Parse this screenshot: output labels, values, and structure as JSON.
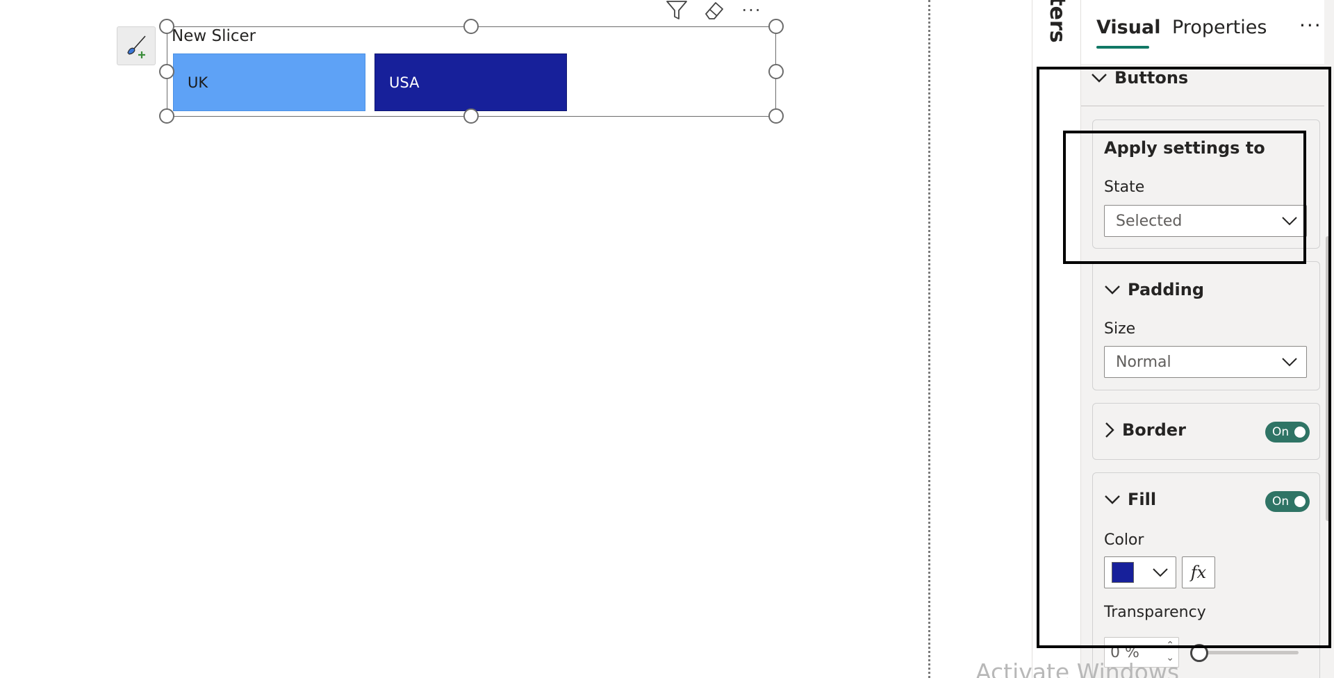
{
  "canvas": {
    "slicer": {
      "title": "New Slicer",
      "buttons": [
        {
          "label": "UK",
          "color": "#5ea2f6",
          "state": "unselected"
        },
        {
          "label": "USA",
          "color": "#17209a",
          "state": "selected"
        }
      ]
    },
    "visual_header": {
      "icons": [
        "filter-icon",
        "eraser-icon",
        "more-options-icon"
      ],
      "more_label": "···"
    },
    "format_button_icon": "format-paintbrush-icon"
  },
  "filters_pane": {
    "label": "Filters",
    "visible_label": "lters"
  },
  "format_pane": {
    "tabs": [
      {
        "label": "Visual",
        "active": true
      },
      {
        "label": "Properties",
        "active": false
      }
    ],
    "more_label": "···",
    "section": {
      "label": "Buttons",
      "expanded": true
    },
    "apply_settings": {
      "title": "Apply settings to",
      "state_label": "State",
      "state_value": "Selected"
    },
    "padding": {
      "title": "Padding",
      "size_label": "Size",
      "size_value": "Normal"
    },
    "border": {
      "title": "Border",
      "toggle_label": "On",
      "expanded": false
    },
    "fill": {
      "title": "Fill",
      "toggle_label": "On",
      "color_label": "Color",
      "color_value": "#17209a",
      "fx_label": "fx",
      "transparency_label": "Transparency",
      "transparency_value": "0 %",
      "transparency_percent": 0
    },
    "accent_color": "#117865",
    "toggle_color": "#2f7465"
  },
  "watermark": "Activate Windows"
}
